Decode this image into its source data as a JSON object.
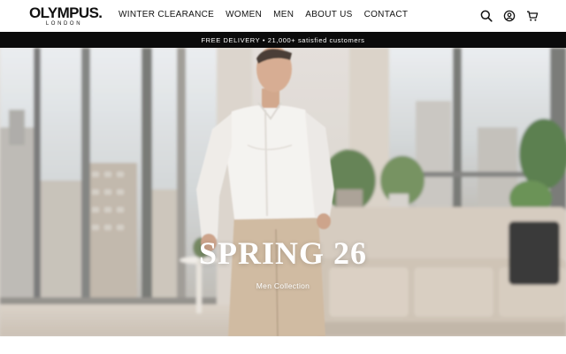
{
  "header": {
    "logo": {
      "main": "OLYMPUS.",
      "sub": "LONDON"
    },
    "nav": [
      {
        "label": "WINTER CLEARANCE"
      },
      {
        "label": "WOMEN"
      },
      {
        "label": "MEN"
      },
      {
        "label": "ABOUT US"
      },
      {
        "label": "CONTACT"
      }
    ],
    "icons": [
      "search-icon",
      "account-icon",
      "cart-icon"
    ]
  },
  "announcement": {
    "text": "FREE DELIVERY • 21,000+ satisfied customers"
  },
  "hero": {
    "title": "SPRING 26",
    "subtitle": "Men Collection"
  },
  "colors": {
    "announcement_bg": "#0b0b0b",
    "text": "#111111",
    "hero_text": "#ffffff"
  }
}
